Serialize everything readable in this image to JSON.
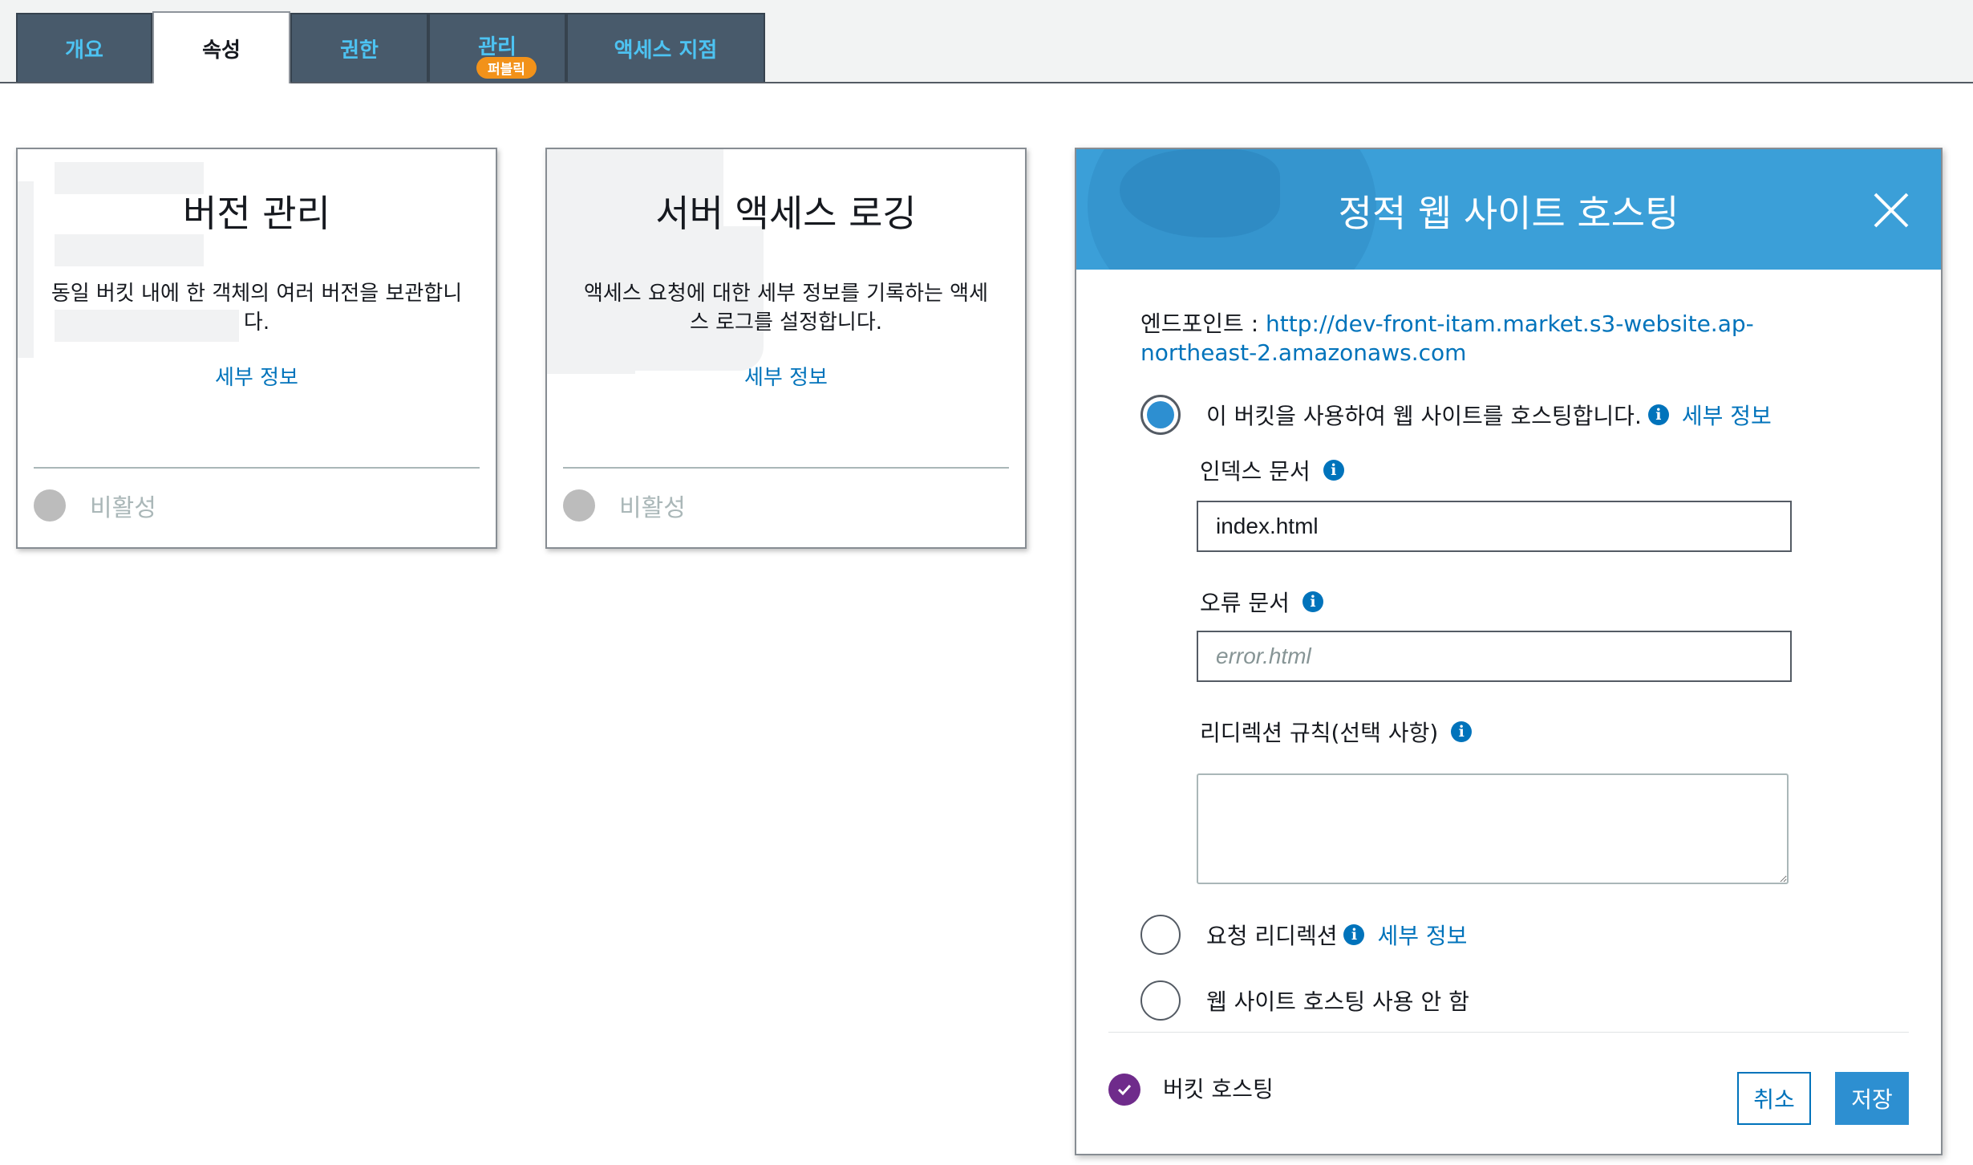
{
  "tabs": [
    {
      "label": "개요"
    },
    {
      "label": "속성",
      "active": true
    },
    {
      "label": "권한"
    },
    {
      "label": "관리",
      "badge": "퍼블릭"
    },
    {
      "label": "액세스 지점"
    }
  ],
  "cards": [
    {
      "title": "버전 관리",
      "description": "동일 버킷 내에 한 객체의 여러 버전을 보관합니다.",
      "link": "세부 정보",
      "status": "비활성"
    },
    {
      "title": "서버 액세스 로깅",
      "description": "액세스 요청에 대한 세부 정보를 기록하는 액세스 로그를 설정합니다.",
      "link": "세부 정보",
      "status": "비활성"
    }
  ],
  "hosting": {
    "title": "정적 웹 사이트 호스팅",
    "endpoint_label": "엔드포인트 : ",
    "endpoint_url": "http://dev-front-itam.market.s3-website.ap-northeast-2.amazonaws.com",
    "options": [
      {
        "label": "이 버킷을 사용하여 웹 사이트를 호스팅합니다.",
        "link": "세부 정보",
        "selected": true
      },
      {
        "label": "요청 리디렉션",
        "link": "세부 정보",
        "selected": false
      },
      {
        "label": "웹 사이트 호스팅 사용 안 함",
        "selected": false
      }
    ],
    "index_label": "인덱스 문서",
    "index_value": "index.html",
    "error_label": "오류 문서",
    "error_placeholder": "error.html",
    "redirect_label": "리디렉션 규칙(선택 사항)",
    "enabled_label": "버킷 호스팅",
    "cancel_label": "취소",
    "save_label": "저장"
  },
  "colors": {
    "tab_bg": "#485a6b",
    "tab_text": "#4dc3f2",
    "header_blue": "#3b9fd8",
    "link": "#0073bb",
    "badge": "#f2921a",
    "check_purple": "#6f2b8b"
  },
  "icons": [
    "info-icon",
    "close-icon",
    "check-icon",
    "globe-icon"
  ]
}
